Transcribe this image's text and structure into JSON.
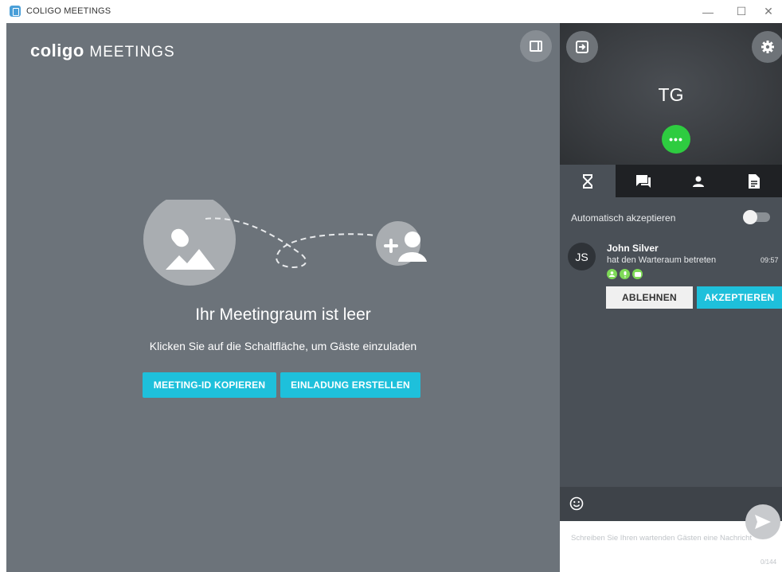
{
  "window": {
    "title": "COLIGO MEETINGS",
    "minimize": "—",
    "maximize": "☐",
    "close": "✕"
  },
  "stage": {
    "brand_bold": "coligo",
    "brand_light": "MEETINGS",
    "empty_title": "Ihr Meetingraum ist leer",
    "empty_subtitle": "Klicken Sie auf die Schaltfläche, um Gäste einzuladen",
    "copy_id_button": "MEETING-ID KOPIEREN",
    "invite_button": "EINLADUNG ERSTELLEN"
  },
  "panel": {
    "initials": "TG",
    "status_dots": "•••",
    "tabs": [
      {
        "icon": "hourglass-icon",
        "active": true
      },
      {
        "icon": "chat-icon",
        "active": false
      },
      {
        "icon": "person-icon",
        "active": false
      },
      {
        "icon": "document-icon",
        "active": false
      }
    ],
    "auto_accept_label": "Automatisch akzeptieren",
    "auto_accept_on": false,
    "guest": {
      "initials": "JS",
      "name": "John Silver",
      "status": "hat den Warteraum betreten",
      "time": "09:57",
      "capabilities": [
        "person-icon",
        "mic-icon",
        "camera-icon"
      ]
    },
    "reject_button": "ABLEHNEN",
    "accept_button": "AKZEPTIEREN",
    "compose_placeholder": "Schreiben Sie Ihren wartenden Gästen eine Nachricht",
    "char_counter": "0/144"
  },
  "colors": {
    "stage_bg": "#6c737a",
    "panel_bg": "#4a5057",
    "accent_cyan": "#1ec0db",
    "status_green": "#2ecc40"
  }
}
